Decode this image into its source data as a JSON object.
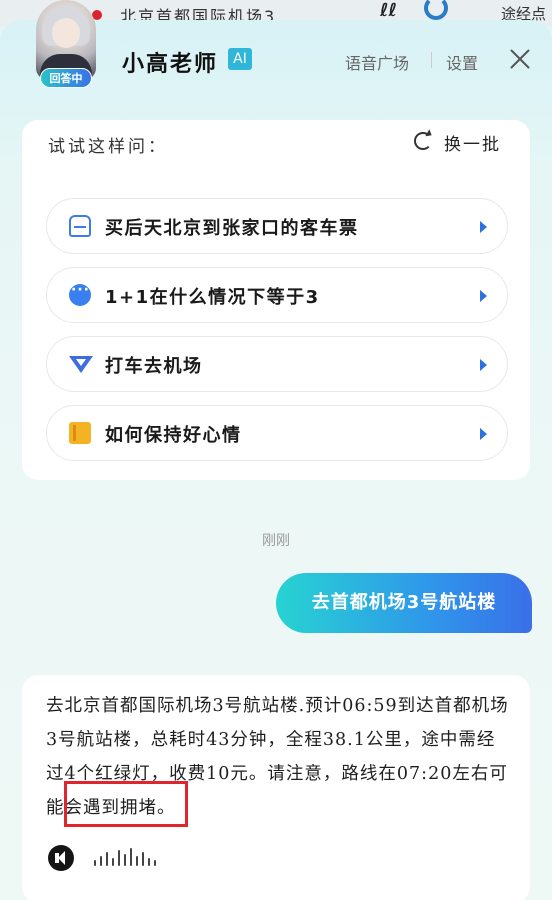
{
  "map": {
    "destination": "北京首都国际机场3",
    "waypoint_label": "途经点",
    "top_glyph": "ℓℓ"
  },
  "header": {
    "assistant_name": "小高老师",
    "ai_tag": "AI",
    "status_badge": "回答中",
    "voice_plaza": "语音广场",
    "settings": "设置",
    "close_icon": "close-icon"
  },
  "suggestions": {
    "title": "试试这样问：",
    "refresh_label": "换一批",
    "items": [
      {
        "icon": "bus-icon",
        "label": "买后天北京到张家口的客车票"
      },
      {
        "icon": "chat-bubble-icon",
        "label": "1+1在什么情况下等于3"
      },
      {
        "icon": "ride-hailing-icon",
        "label": "打车去机场"
      },
      {
        "icon": "book-icon",
        "label": "如何保持好心情"
      }
    ]
  },
  "chat": {
    "timestamp": "刚刚",
    "user_message": "去首都机场3号航站楼",
    "answer": "去北京首都国际机场3号航站楼.预计06:59到达首都机场3号航站楼，总耗时43分钟，全程38.1公里，途中需经过4个红绿灯，收费10元。请注意，路线在07:20左右可能会遇到拥堵。",
    "highlight_color": "#e0262c"
  },
  "colors": {
    "accent_blue": "#2f6fe0",
    "bubble_start": "#27d3d2",
    "bubble_end": "#3a6fe8"
  }
}
